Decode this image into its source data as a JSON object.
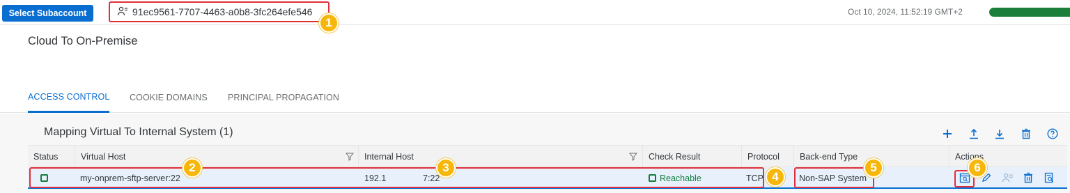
{
  "topbar": {
    "select_label": "Select Subaccount",
    "subaccount_id": "91ec9561-7707-4463-a0b8-3fc264efe546",
    "datetime": "Oct 10, 2024, 11:52:19 GMT+2"
  },
  "page": {
    "title": "Cloud To On-Premise"
  },
  "tabs": [
    {
      "label": "ACCESS CONTROL",
      "active": true
    },
    {
      "label": "COOKIE DOMAINS",
      "active": false
    },
    {
      "label": "PRINCIPAL PROPAGATION",
      "active": false
    }
  ],
  "table": {
    "title": "Mapping Virtual To Internal System",
    "count": "(1)",
    "columns": [
      "Status",
      "Virtual Host",
      "Internal Host",
      "Check Result",
      "Protocol",
      "Back-end Type",
      "Actions"
    ],
    "rows": [
      {
        "virtual_host": "my-onprem-sftp-server:22",
        "internal_host_a": "192.1",
        "internal_host_b": "7:22",
        "check_result": "Reachable",
        "protocol": "TCP",
        "backend_type": "Non-SAP System"
      }
    ]
  },
  "toolbar_icons": [
    "add-icon",
    "upload-icon",
    "download-icon",
    "delete-icon",
    "help-icon"
  ],
  "row_action_icons": [
    "check-availability-icon",
    "edit-icon",
    "principal-icon",
    "delete-icon",
    "details-icon"
  ],
  "annotations": [
    "1",
    "2",
    "3",
    "4",
    "5",
    "6"
  ],
  "colors": {
    "accent": "#0a6ed1",
    "positive": "#107e3e",
    "highlight": "#e0303a",
    "badge": "#f6b70a"
  }
}
